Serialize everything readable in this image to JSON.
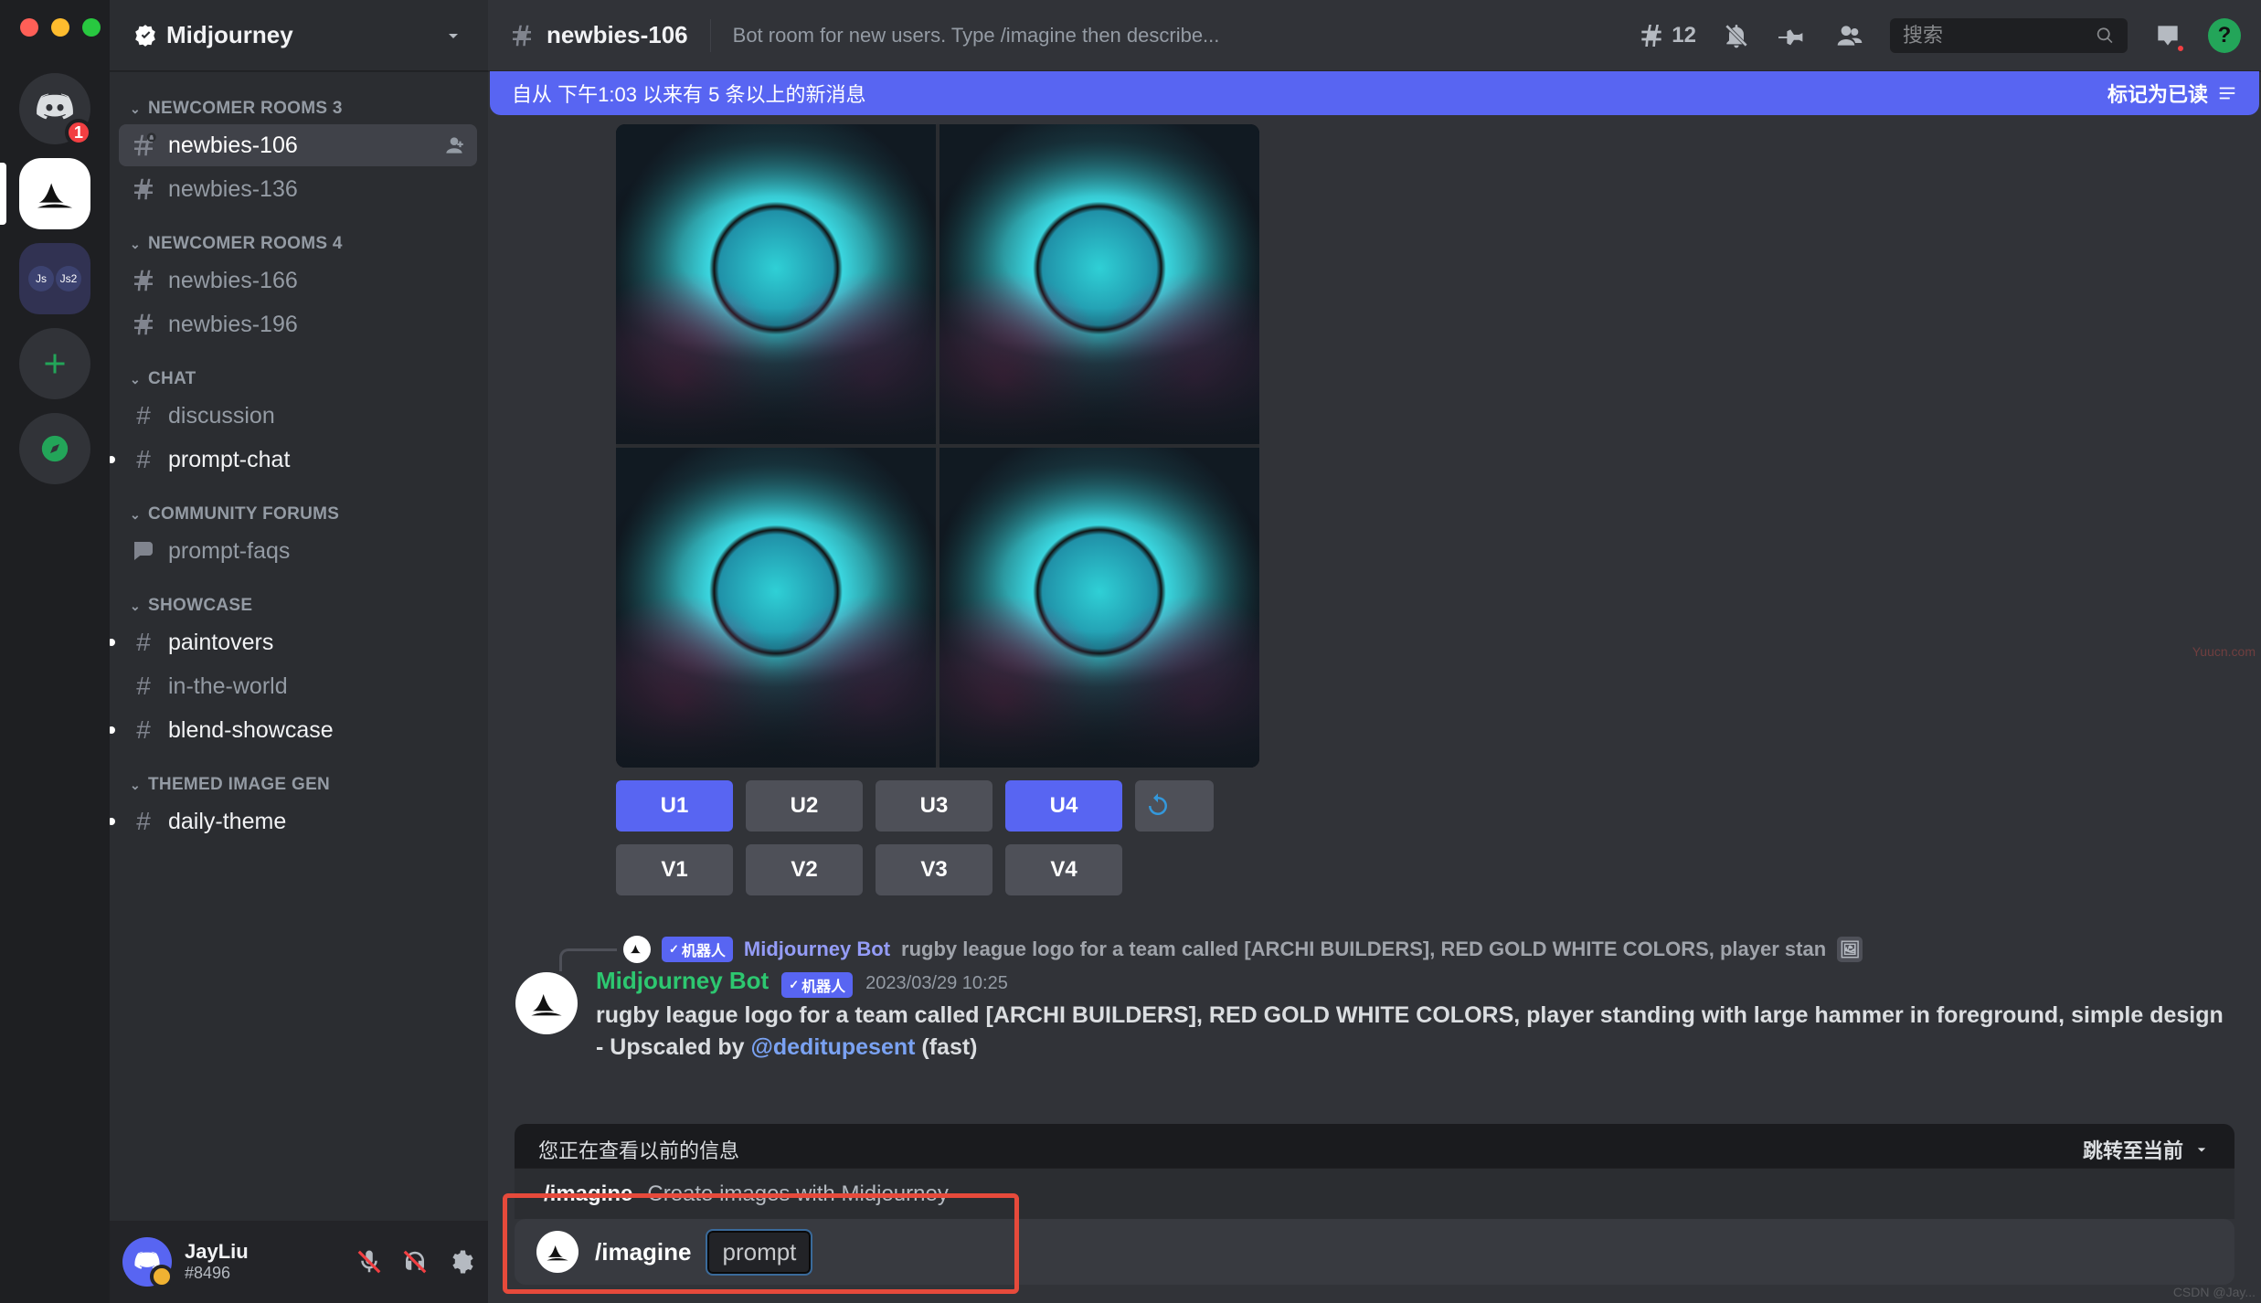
{
  "window": {
    "server_name": "Midjourney"
  },
  "rail": {
    "discord_badge": "1",
    "mini_labels": [
      "Js",
      "Js2"
    ]
  },
  "sidebar": {
    "categories": [
      {
        "label": "NEWCOMER ROOMS 3",
        "channels": [
          {
            "name": "newbies-106",
            "selected": true,
            "has_add_user": true
          },
          {
            "name": "newbies-136"
          }
        ]
      },
      {
        "label": "NEWCOMER ROOMS 4",
        "channels": [
          {
            "name": "newbies-166"
          },
          {
            "name": "newbies-196"
          }
        ]
      },
      {
        "label": "CHAT",
        "channels": [
          {
            "name": "discussion",
            "type": "text"
          },
          {
            "name": "prompt-chat",
            "unread": true,
            "type": "text"
          }
        ]
      },
      {
        "label": "COMMUNITY FORUMS",
        "channels": [
          {
            "name": "prompt-faqs",
            "type": "forum"
          }
        ]
      },
      {
        "label": "SHOWCASE",
        "channels": [
          {
            "name": "paintovers",
            "unread": true
          },
          {
            "name": "in-the-world"
          },
          {
            "name": "blend-showcase",
            "unread": true
          }
        ]
      },
      {
        "label": "THEMED IMAGE GEN",
        "channels": [
          {
            "name": "daily-theme",
            "unread": true
          }
        ]
      }
    ]
  },
  "user_panel": {
    "name": "JayLiu",
    "discriminator": "#8496"
  },
  "topbar": {
    "channel_name": "newbies-106",
    "topic": "Bot room for new users. Type /imagine then describe...",
    "threads_count": "12",
    "search_placeholder": "搜索"
  },
  "banner": {
    "text": "自从 下午1:03 以来有 5 条以上的新消息",
    "mark_read": "标记为已读"
  },
  "buttons": {
    "u_row": [
      "U1",
      "U2",
      "U3",
      "U4"
    ],
    "v_row": [
      "V1",
      "V2",
      "V3",
      "V4"
    ]
  },
  "reply": {
    "bot_chip": "机器人",
    "username": "Midjourney Bot",
    "text": "rugby league logo for a team called [ARCHI BUILDERS], RED GOLD WHITE COLORS, player stan"
  },
  "message": {
    "username": "Midjourney Bot",
    "bot_chip": "机器人",
    "timestamp": "2023/03/29 10:25",
    "text_prefix": "rugby league logo for a team called [ARCHI BUILDERS], RED GOLD WHITE COLORS, player standing with large hammer in foreground, simple design",
    "text_middle": " - Upscaled by ",
    "mention": "@deditupesent",
    "text_suffix": " (fast)"
  },
  "old_bar": {
    "text": "您正在查看以前的信息",
    "jump": "跳转至当前"
  },
  "cmd_suggest": {
    "name": "/imagine",
    "desc": "Create images with Midjourney"
  },
  "compose": {
    "slash": "/imagine",
    "prompt_label": "prompt"
  },
  "colors": {
    "blurple": "#5865f2",
    "green": "#23a559",
    "botname_green": "#2dc770"
  },
  "watermarks": {
    "yuucn": "Yuucn.com",
    "csdn": "CSDN @Jay..."
  }
}
